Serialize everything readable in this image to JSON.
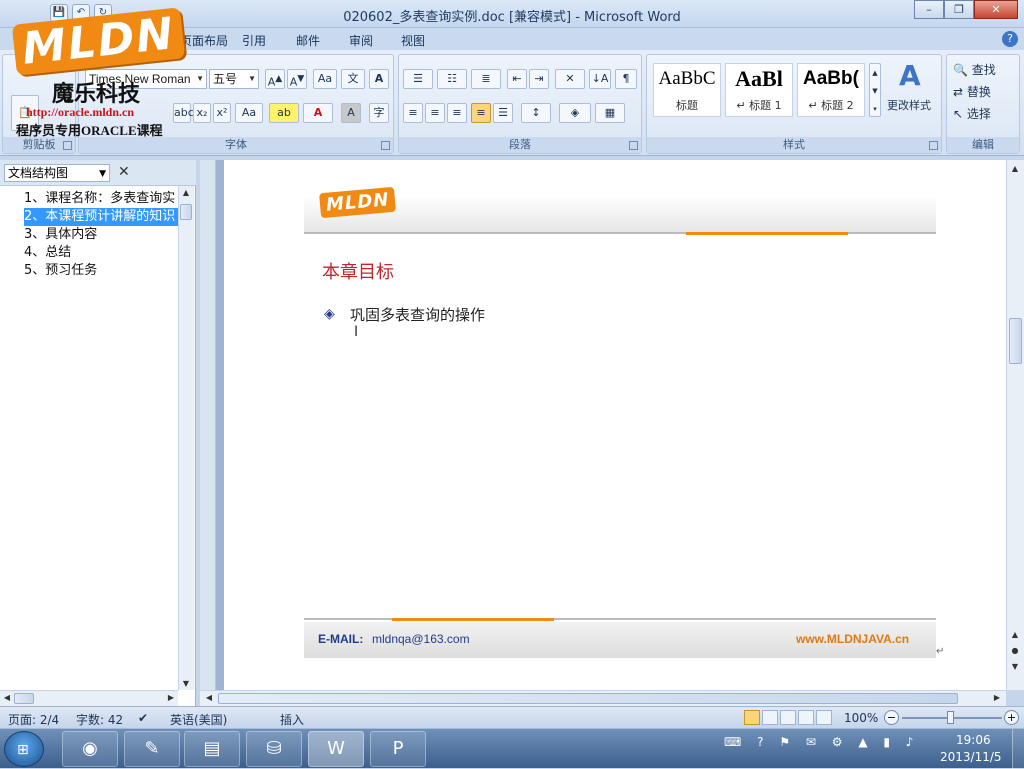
{
  "window": {
    "title": "020602_多表查询实例.doc [兼容模式] - Microsoft Word",
    "controls": {
      "minimize": "–",
      "restore": "❐",
      "close": "✕"
    }
  },
  "quick_access": [
    "💾",
    "↶",
    "↻"
  ],
  "ribbon_tabs": [
    "页面布局",
    "引用",
    "邮件",
    "审阅",
    "视图"
  ],
  "ribbon": {
    "clipboard": {
      "label": "剪贴板",
      "paste": "粘贴"
    },
    "font": {
      "label": "字体",
      "font_name": "Times New Roman",
      "font_size": "五号"
    },
    "paragraph": {
      "label": "段落"
    },
    "styles": {
      "label": "样式",
      "items": [
        {
          "sample": "AaBbC",
          "name": "标题"
        },
        {
          "sample": "AaBl",
          "name": "↵ 标题 1"
        },
        {
          "sample": "AaBb(",
          "name": "↵ 标题 2"
        }
      ],
      "change_styles": "更改样式"
    },
    "editing": {
      "label": "编辑",
      "find": "查找",
      "replace": "替换",
      "select": "选择"
    }
  },
  "logo": {
    "brand": "MLDN",
    "name_cn": "魔乐科技",
    "url": "http://oracle.mldn.cn",
    "subtitle": "程序员专用ORACLE课程"
  },
  "nav_pane": {
    "view_select": "文档结构图",
    "close": "✕",
    "items": [
      {
        "label": "1、课程名称：多表查询实",
        "selected": false
      },
      {
        "label": "2、本课程预计讲解的知识",
        "selected": true
      },
      {
        "label": "3、具体内容",
        "selected": false
      },
      {
        "label": "4、总结",
        "selected": false
      },
      {
        "label": "5、预习任务",
        "selected": false
      }
    ]
  },
  "document": {
    "header_logo": "MLDN",
    "title": "本章目标",
    "bullets": [
      "巩固多表查询的操作"
    ],
    "footer": {
      "email_label": "E-MAIL:",
      "email": "mldnqa@163.com",
      "site": "www.MLDNJAVA.cn"
    }
  },
  "statusbar": {
    "page": "页面: 2/4",
    "words": "字数: 42",
    "language": "英语(美国)",
    "mode": "插入",
    "zoom": "100%",
    "zoom_level": 1.0
  },
  "taskbar": {
    "time": "19:06",
    "date": "2013/11/5"
  },
  "colors": {
    "accent_orange": "#f08a12",
    "title_red": "#c0262d",
    "selection_blue": "#3399ff"
  }
}
